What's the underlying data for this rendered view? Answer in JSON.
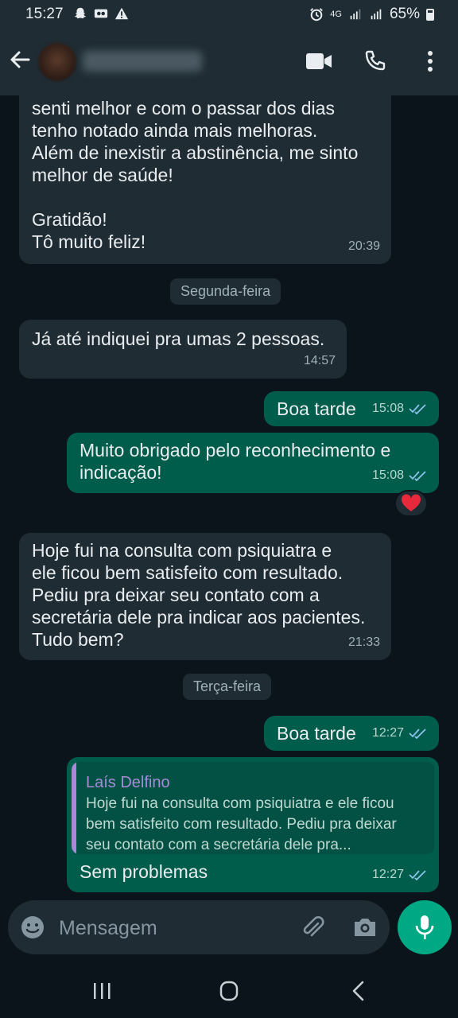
{
  "status_bar": {
    "time": "15:27",
    "network": "4G",
    "battery": "65%"
  },
  "header": {
    "contact_name": "Laís Delfino",
    "icons": [
      "back-arrow-icon",
      "video-call-icon",
      "phone-icon",
      "more-options-icon"
    ]
  },
  "messages": [
    {
      "direction": "in",
      "text": "senti melhor e com o passar dos dias\ntenho notado ainda mais melhoras.\nAlém de inexistir a abstinência, me sinto\nmelhor de saúde!\n\nGratidão!\nTô muito feliz!",
      "time": "20:39"
    },
    {
      "direction": "in",
      "text": "Já até indiquei pra umas 2 pessoas.",
      "time": "14:57"
    },
    {
      "direction": "out",
      "text": "Boa tarde",
      "time": "15:08"
    },
    {
      "direction": "out",
      "text": "Muito obrigado pelo reconhecimento e\nindicação!",
      "time": "15:08",
      "reaction": "❤️"
    },
    {
      "direction": "in",
      "text": "Hoje fui na consulta com psiquiatra e\nele ficou bem satisfeito com resultado.\nPediu pra deixar seu contato com a\nsecretária dele pra indicar aos pacientes.\nTudo bem?",
      "time": "21:33"
    },
    {
      "direction": "out",
      "text": "Boa tarde",
      "time": "12:27"
    },
    {
      "direction": "out",
      "text": "Sem problemas",
      "time": "12:27",
      "quote": {
        "author": "Laís Delfino",
        "text": "Hoje fui na consulta com psiquiatra e ele ficou bem satisfeito com resultado. Pediu pra deixar seu contato com a secretária dele pra..."
      }
    }
  ],
  "date_separators": [
    "Segunda-feira",
    "Terça-feira"
  ],
  "composer": {
    "placeholder": "Mensagem"
  },
  "colors": {
    "background": "#0b141a",
    "incoming_bubble": "#1f2c34",
    "outgoing_bubble": "#005c4b",
    "accent": "#00a884",
    "read_ticks": "#8dc3ea",
    "quote_author": "#a88bd8"
  }
}
